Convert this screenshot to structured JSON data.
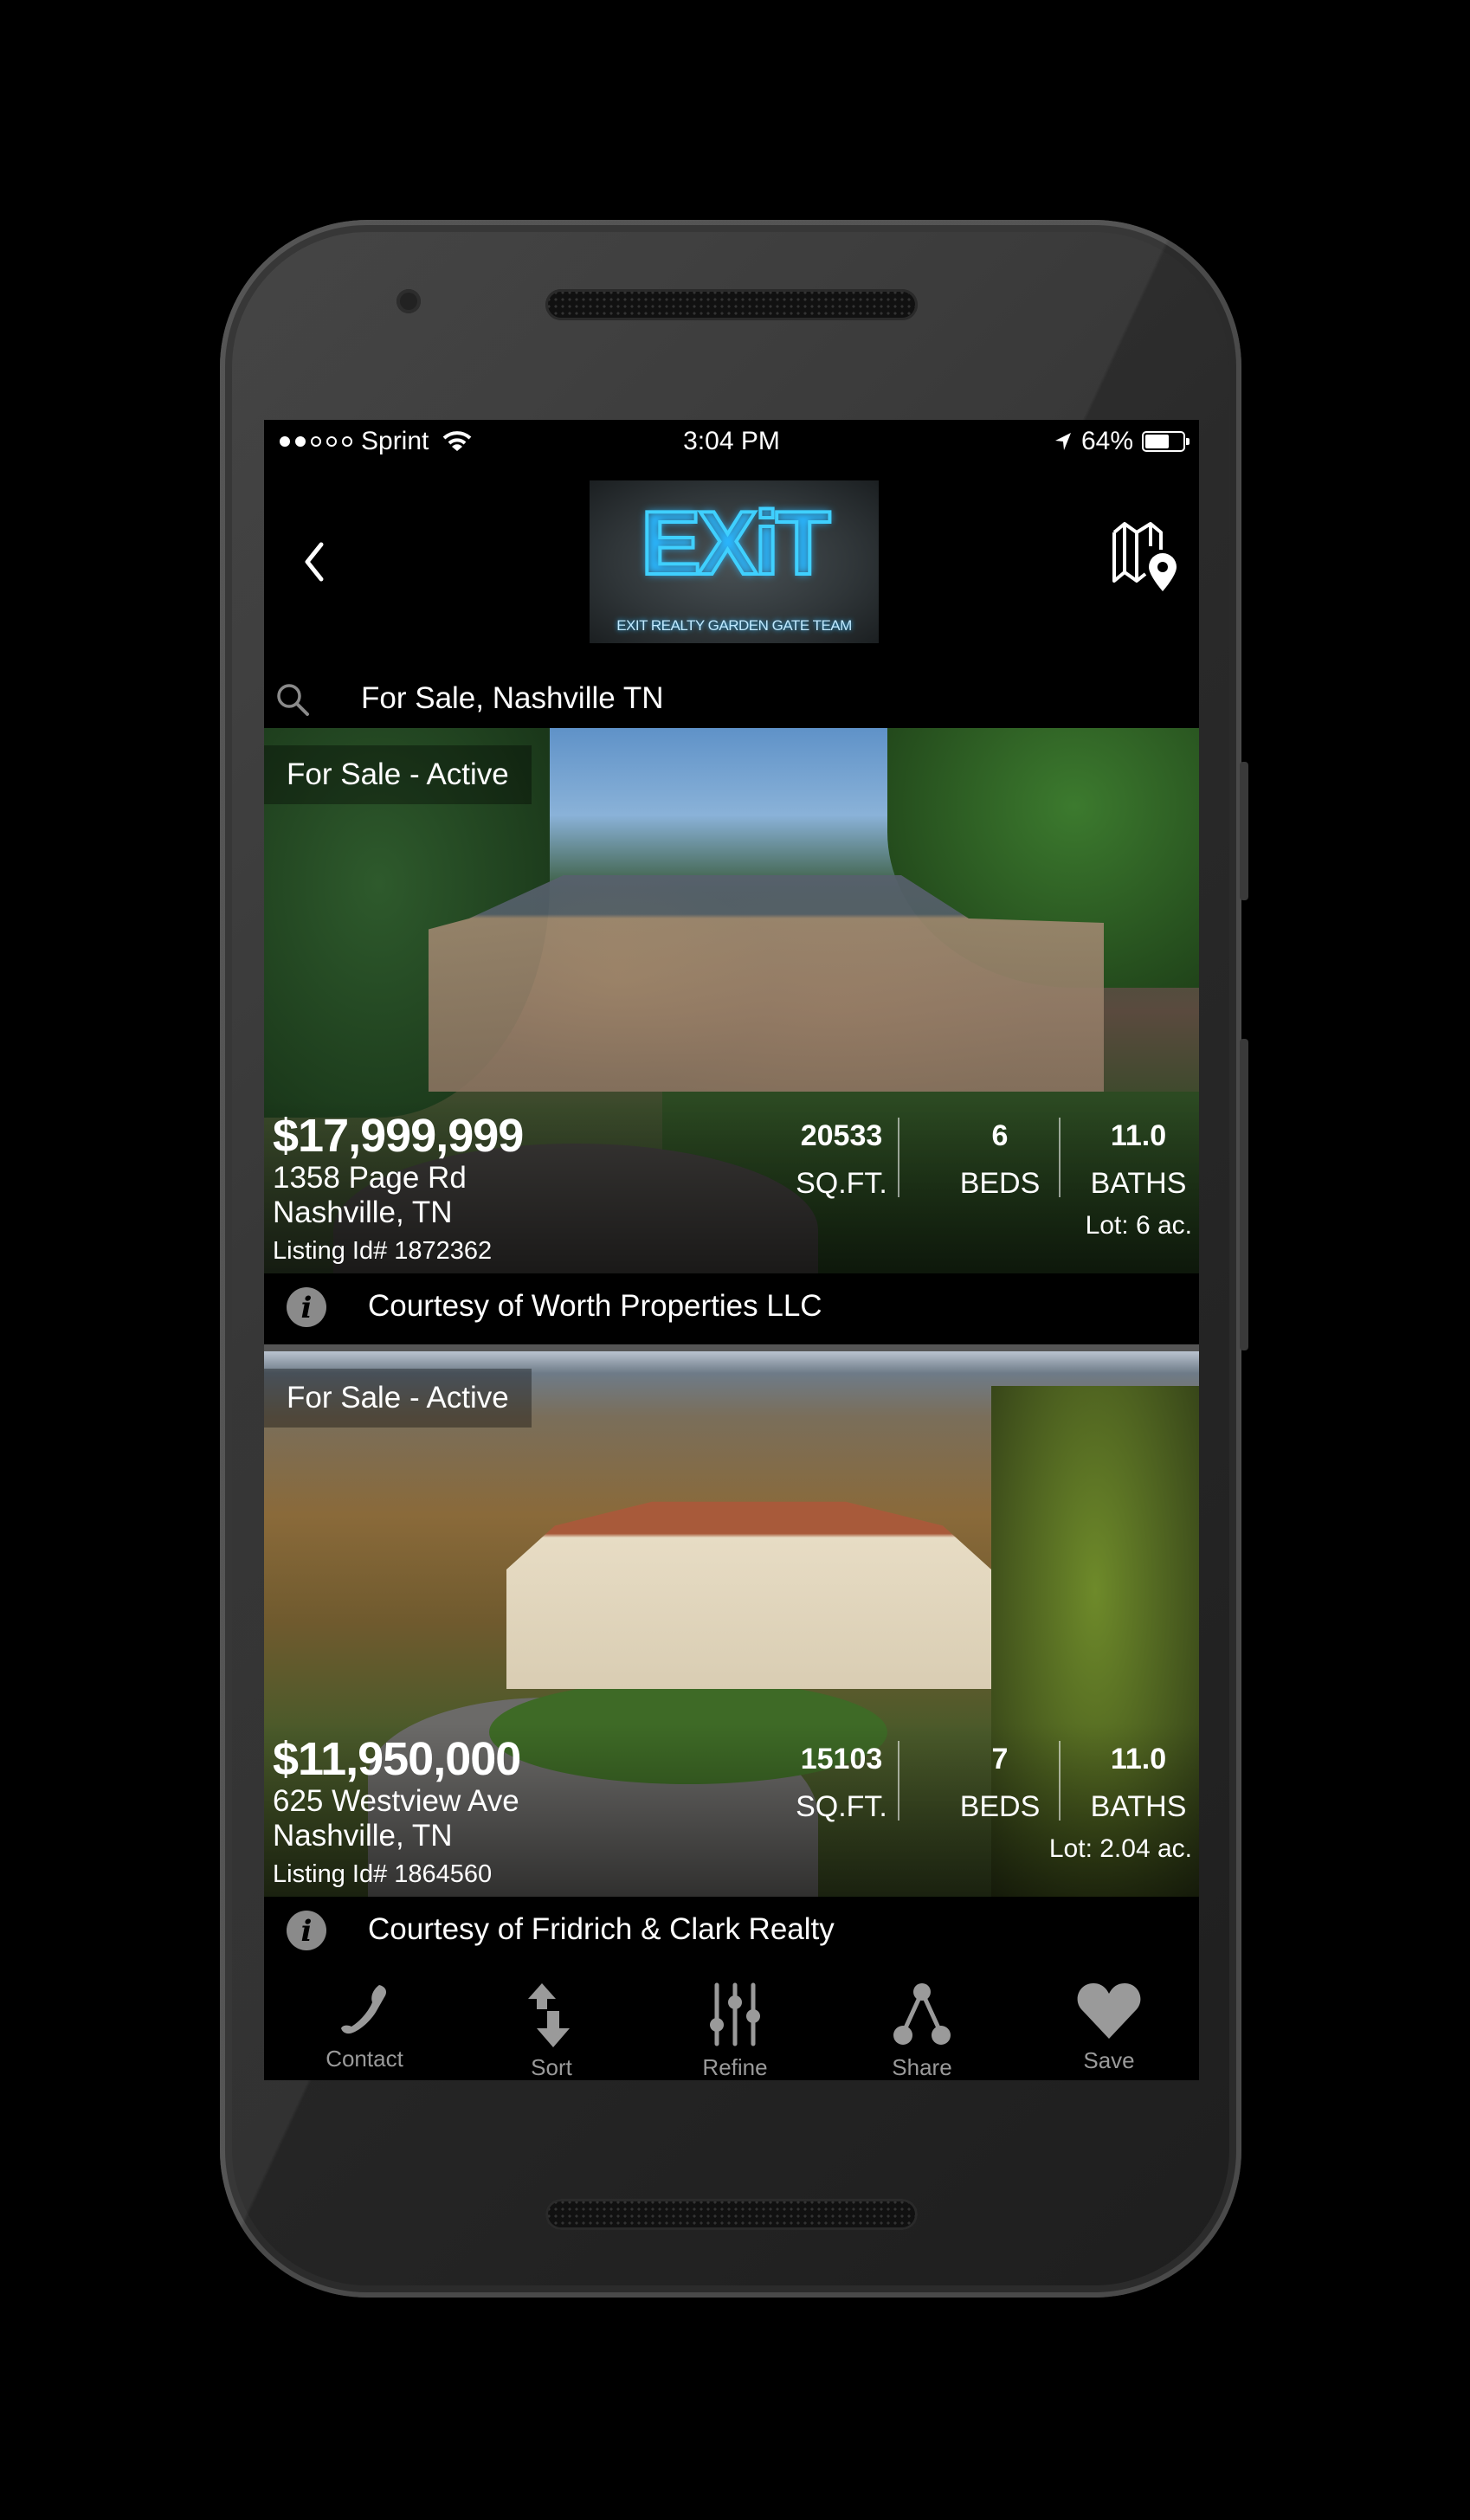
{
  "status_bar": {
    "signal_dots_filled": 2,
    "signal_dots_total": 5,
    "carrier": "Sprint",
    "time": "3:04 PM",
    "battery_percent_label": "64%",
    "battery_level": 0.64,
    "icons": [
      "wifi-icon",
      "location-arrow-icon",
      "battery-icon"
    ]
  },
  "header": {
    "back_icon": "chevron-left-icon",
    "logo": {
      "wordmark": "EXiT",
      "tagline": "EXIT REALTY GARDEN GATE TEAM",
      "accent_color": "#3fd0ff"
    },
    "map_icon": "map-pin-icon"
  },
  "search": {
    "icon": "search-icon",
    "query": "For Sale, Nashville TN"
  },
  "listings": [
    {
      "status": "For Sale - Active",
      "price": "$17,999,999",
      "address_line1": "1358 Page Rd",
      "address_line2": "Nashville, TN",
      "listing_id": "Listing Id# 1872362",
      "sqft": "20533",
      "sqft_label": "SQ.FT.",
      "beds": "6",
      "beds_label": "BEDS",
      "baths": "11.0",
      "baths_label": "BATHS",
      "lot": "Lot: 6 ac.",
      "courtesy": "Courtesy of Worth Properties LLC"
    },
    {
      "status": "For Sale - Active",
      "price": "$11,950,000",
      "address_line1": "625 Westview Ave",
      "address_line2": "Nashville, TN",
      "listing_id": "Listing Id# 1864560",
      "sqft": "15103",
      "sqft_label": "SQ.FT.",
      "beds": "7",
      "beds_label": "BEDS",
      "baths": "11.0",
      "baths_label": "BATHS",
      "lot": "Lot: 2.04 ac.",
      "courtesy": "Courtesy of Fridrich & Clark Realty"
    }
  ],
  "tabbar": {
    "items": [
      {
        "label": "Contact",
        "icon": "phone-icon"
      },
      {
        "label": "Sort",
        "icon": "sort-arrows-icon"
      },
      {
        "label": "Refine",
        "icon": "sliders-icon"
      },
      {
        "label": "Share",
        "icon": "share-icon"
      },
      {
        "label": "Save",
        "icon": "heart-icon"
      }
    ],
    "icon_color": "#9a9a9a"
  }
}
